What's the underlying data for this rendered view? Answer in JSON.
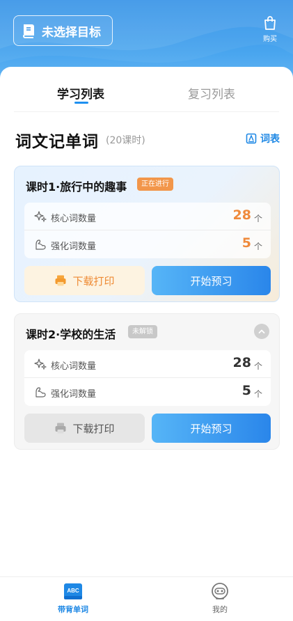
{
  "header": {
    "goal_label": "未选择目标",
    "buy_label": "购买"
  },
  "tabs": [
    {
      "label": "学习列表",
      "active": true
    },
    {
      "label": "复习列表",
      "active": false
    }
  ],
  "book": {
    "title": "词文记单词",
    "lesson_count": "(20课时)",
    "wordlist_link": "词表"
  },
  "lessons": [
    {
      "title": "课时1·旅行中的趣事",
      "status": "正在进行",
      "core_label": "核心词数量",
      "core_count": "28",
      "core_unit": "个",
      "extra_label": "强化词数量",
      "extra_count": "5",
      "extra_unit": "个",
      "print_label": "下载打印",
      "start_label": "开始预习"
    },
    {
      "title": "课时2·学校的生活",
      "status": "未解锁",
      "core_label": "核心词数量",
      "core_count": "28",
      "core_unit": "个",
      "extra_label": "强化词数量",
      "extra_count": "5",
      "extra_unit": "个",
      "print_label": "下载打印",
      "start_label": "开始预习"
    }
  ],
  "bottom_nav": [
    {
      "label": "带背单词",
      "icon": "abc-book-icon",
      "active": true
    },
    {
      "label": "我的",
      "icon": "robot-face-icon",
      "active": false
    }
  ],
  "colors": {
    "accent": "#1e88e5",
    "status_active": "#f2964a",
    "status_locked": "#c8c8c8",
    "highlight_number": "#ef8a3c"
  }
}
